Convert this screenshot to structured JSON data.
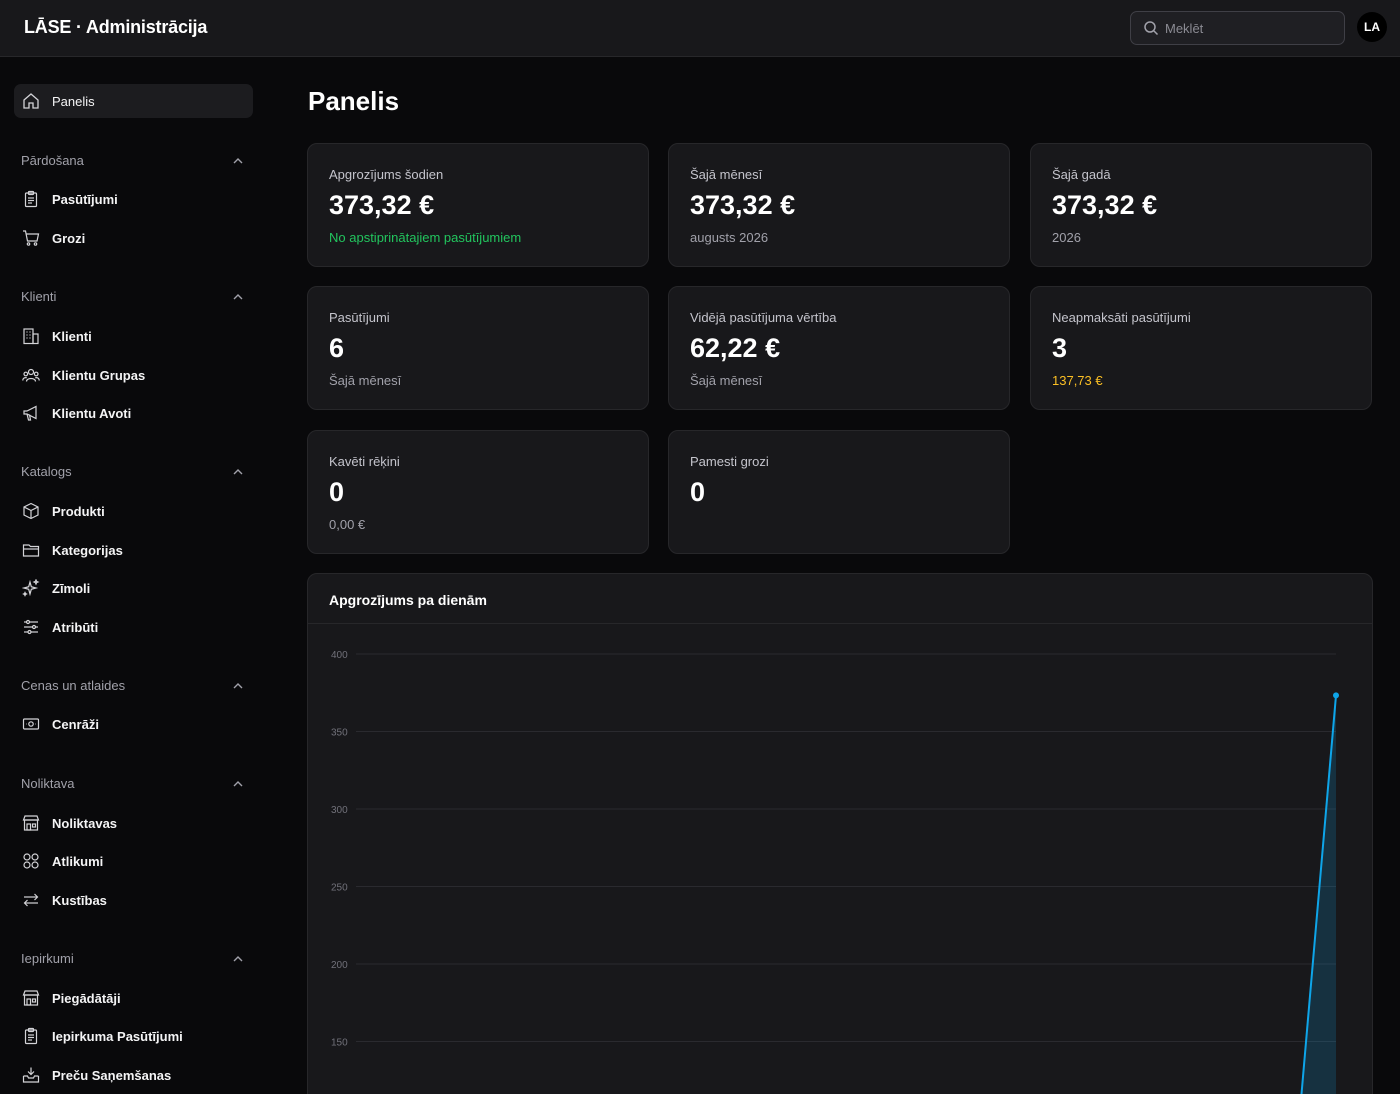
{
  "app": {
    "title": "LĀSE · Administrācija",
    "user_initials": "LA"
  },
  "search": {
    "placeholder": "Meklēt"
  },
  "sidebar": {
    "top_item": {
      "label": "Panelis",
      "icon": "home-icon"
    },
    "groups": [
      {
        "label": "Pārdošana",
        "items": [
          {
            "label": "Pasūtījumi",
            "icon": "clipboard-icon"
          },
          {
            "label": "Grozi",
            "icon": "cart-icon"
          }
        ]
      },
      {
        "label": "Klienti",
        "items": [
          {
            "label": "Klienti",
            "icon": "building-icon"
          },
          {
            "label": "Klientu Grupas",
            "icon": "users-icon"
          },
          {
            "label": "Klientu Avoti",
            "icon": "megaphone-icon"
          }
        ]
      },
      {
        "label": "Katalogs",
        "items": [
          {
            "label": "Produkti",
            "icon": "box-icon"
          },
          {
            "label": "Kategorijas",
            "icon": "folder-icon"
          },
          {
            "label": "Zīmoli",
            "icon": "sparkles-icon"
          },
          {
            "label": "Atribūti",
            "icon": "sliders-icon"
          }
        ]
      },
      {
        "label": "Cenas un atlaides",
        "items": [
          {
            "label": "Cenrāži",
            "icon": "banknote-icon"
          }
        ]
      },
      {
        "label": "Noliktava",
        "items": [
          {
            "label": "Noliktavas",
            "icon": "warehouse-icon"
          },
          {
            "label": "Atlikumi",
            "icon": "grid-icon"
          },
          {
            "label": "Kustības",
            "icon": "arrows-icon"
          }
        ]
      },
      {
        "label": "Iepirkumi",
        "items": [
          {
            "label": "Piegādātāji",
            "icon": "store-icon"
          },
          {
            "label": "Iepirkuma Pasūtījumi",
            "icon": "clipboard-icon"
          },
          {
            "label": "Preču Saņemšanas",
            "icon": "inbox-download-icon"
          }
        ]
      }
    ]
  },
  "main": {
    "title": "Panelis",
    "cards": [
      {
        "title": "Apgrozījums šodien",
        "value": "373,32 €",
        "sub": "No apstiprinātajiem pasūtījumiem",
        "sub_color": "green"
      },
      {
        "title": "Šajā mēnesī",
        "value": "373,32 €",
        "sub": "augusts 2026",
        "sub_color": "muted"
      },
      {
        "title": "Šajā gadā",
        "value": "373,32 €",
        "sub": "2026",
        "sub_color": "muted"
      },
      {
        "title": "Pasūtījumi",
        "value": "6",
        "sub": "Šajā mēnesī",
        "sub_color": "muted"
      },
      {
        "title": "Vidējā pasūtījuma vērtība",
        "value": "62,22 €",
        "sub": "Šajā mēnesī",
        "sub_color": "muted"
      },
      {
        "title": "Neapmaksāti pasūtījumi",
        "value": "3",
        "sub": "137,73 €",
        "sub_color": "amber"
      },
      {
        "title": "Kavēti rēķini",
        "value": "0",
        "sub": "0,00 €",
        "sub_color": "muted"
      },
      {
        "title": "Pamesti grozi",
        "value": "0",
        "sub": "",
        "sub_color": "muted"
      }
    ]
  },
  "chart_data": {
    "type": "area",
    "title": "Apgrozījums pa dienām",
    "xlabel": "",
    "ylabel": "",
    "y_ticks": [
      150,
      200,
      250,
      300,
      350,
      400
    ],
    "ylim": [
      100,
      400
    ],
    "grid": true,
    "series": [
      {
        "values": [
          0,
          373.32
        ],
        "color": "#0ea5e9"
      }
    ]
  },
  "colors": {
    "accent": "#0ea5e9",
    "positive": "#22c55e",
    "warning": "#fbbf24",
    "background": "#09090b",
    "card": "#18181b"
  }
}
